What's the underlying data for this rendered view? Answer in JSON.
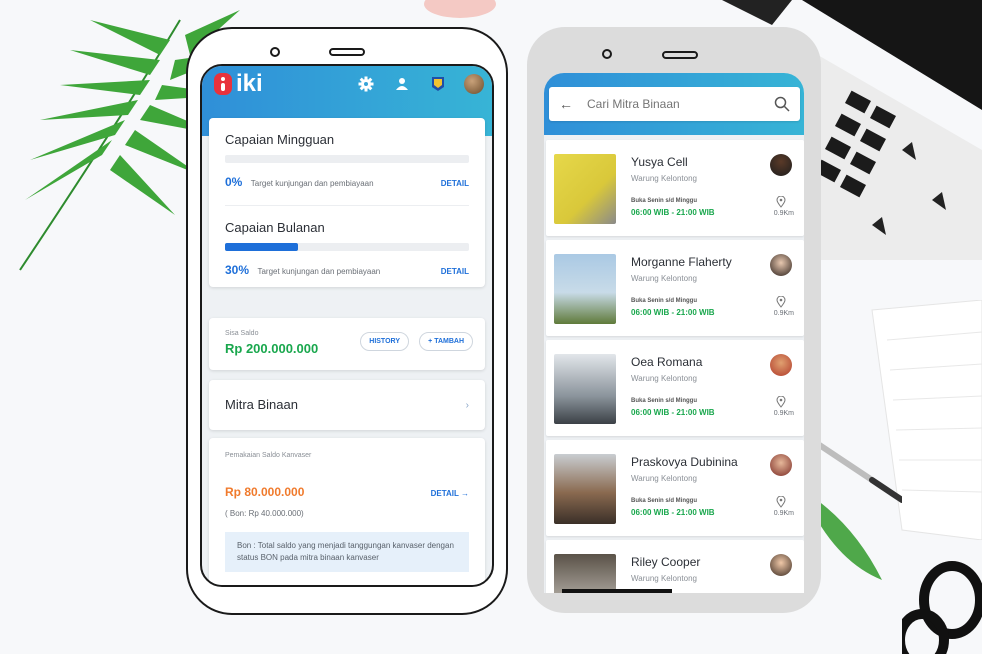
{
  "phone_left": {
    "logo_text": "iki",
    "header_icons": [
      "gear-icon",
      "user-icon",
      "badge-icon",
      "avatar"
    ],
    "capaian_mingguan": {
      "title": "Capaian Mingguan",
      "percent_label": "0%",
      "progress": 0,
      "description": "Target kunjungan dan pembiayaan",
      "detail_label": "DETAIL"
    },
    "capaian_bulanan": {
      "title": "Capaian Bulanan",
      "percent_label": "30%",
      "progress": 0.3,
      "description": "Target kunjungan dan pembiayaan",
      "detail_label": "DETAIL"
    },
    "saldo": {
      "label": "Sisa Saldo",
      "value": "Rp 200.000.000",
      "history_label": "HISTORY",
      "tambah_label": "+ TAMBAH"
    },
    "mitra": {
      "title": "Mitra Binaan"
    },
    "pemakaian": {
      "label": "Pemakaian Saldo Kanvaser",
      "value": "Rp 80.000.000",
      "detail_label": "DETAIL",
      "bon": "( Bon: Rp 40.000.000)",
      "note": "Bon : Total saldo yang menjadi tanggungan kanvaser dengan status BON pada mitra binaan kanvaser"
    },
    "colors": {
      "header_start": "#2f8fd8",
      "header_end": "#37b4d6",
      "brand_red": "#e8323c",
      "accent_blue": "#1e6fd9",
      "green": "#19a74d",
      "orange": "#f07a2c"
    }
  },
  "phone_right": {
    "search": {
      "placeholder": "Cari Mitra Binaan"
    },
    "items": [
      {
        "name": "Yusya Cell",
        "category": "Warung Kelontong",
        "open_days": "Buka Senin s/d Minggu",
        "hours": "06:00 WIB - 21:00 WIB",
        "distance": "0.9Km"
      },
      {
        "name": "Morganne Flaherty",
        "category": "Warung Kelontong",
        "open_days": "Buka Senin s/d Minggu",
        "hours": "06:00 WIB - 21:00 WIB",
        "distance": "0.9Km"
      },
      {
        "name": "Oea Romana",
        "category": "Warung Kelontong",
        "open_days": "Buka Senin s/d Minggu",
        "hours": "06:00 WIB - 21:00 WIB",
        "distance": "0.9Km"
      },
      {
        "name": "Praskovya Dubinina",
        "category": "Warung Kelontong",
        "open_days": "Buka Senin s/d Minggu",
        "hours": "06:00 WIB - 21:00 WIB",
        "distance": "0.9Km"
      },
      {
        "name": "Riley Cooper",
        "category": "Warung Kelontong"
      }
    ]
  }
}
